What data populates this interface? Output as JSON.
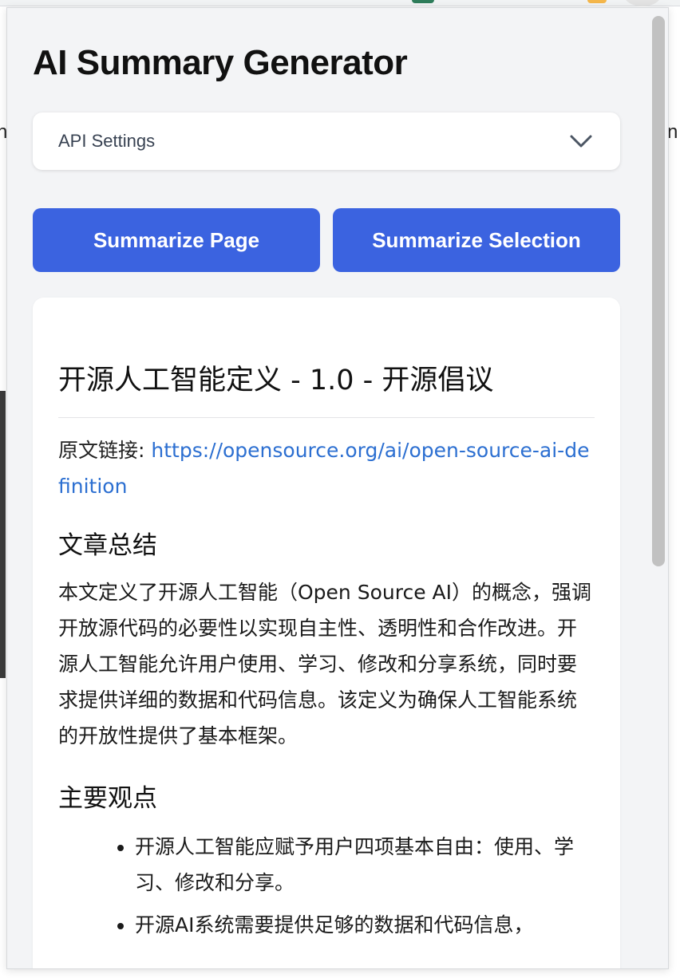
{
  "popup": {
    "title": "AI Summary Generator",
    "settings": {
      "label": "API Settings",
      "icon": "chevron-down-icon"
    },
    "buttons": {
      "summarize_page": "Summarize Page",
      "summarize_selection": "Summarize Selection"
    },
    "colors": {
      "primary_button": "#3b63e0",
      "link": "#2c6fd1",
      "background": "#f3f4f6"
    }
  },
  "summary": {
    "article_title": "开源人工智能定义 - 1.0 - 开源倡议",
    "source_label": "原文链接: ",
    "source_url": "https://opensource.org/ai/open-source-ai-definition",
    "summary_heading": "文章总结",
    "summary_text": "本文定义了开源人工智能（Open Source AI）的概念，强调开放源代码的必要性以实现自主性、透明性和合作改进。开源人工智能允许用户使用、学习、修改和分享系统，同时要求提供详细的数据和代码信息。该定义为确保人工智能系统的开放性提供了基本框架。",
    "points_heading": "主要观点",
    "points": [
      "开源人工智能应赋予用户四项基本自由：使用、学习、修改和分享。",
      "开源AI系统需要提供足够的数据和代码信息，"
    ]
  }
}
